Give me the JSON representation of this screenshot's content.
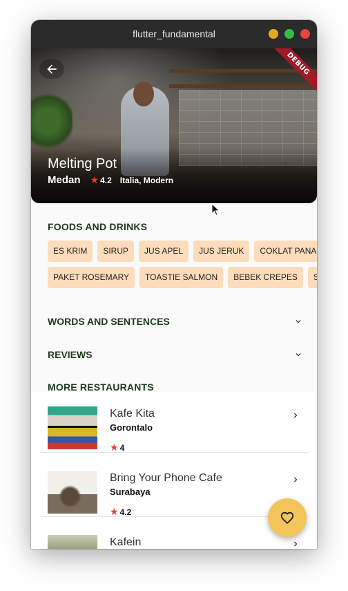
{
  "window": {
    "title": "flutter_fundamental"
  },
  "debug_banner": "DEBUG",
  "hero": {
    "name": "Melting Pot",
    "city": "Medan",
    "rating": "4.2",
    "categories": "Italia, Modern"
  },
  "foods_drinks": {
    "title": "FOODS AND DRINKS",
    "row1": [
      "ES KRIM",
      "SIRUP",
      "JUS APEL",
      "JUS JERUK",
      "COKLAT PANAS"
    ],
    "row2": [
      "PAKET ROSEMARY",
      "TOASTIE SALMON",
      "BEBEK CREPES",
      "SALAD"
    ]
  },
  "sections": {
    "words": "WORDS AND SENTENCES",
    "reviews": "REVIEWS",
    "more": "MORE RESTAURANTS"
  },
  "restaurants": [
    {
      "name": "Kafe Kita",
      "city": "Gorontalo",
      "rating": "4"
    },
    {
      "name": "Bring Your Phone Cafe",
      "city": "Surabaya",
      "rating": "4.2"
    },
    {
      "name": "Kafein",
      "city": "",
      "rating": ""
    }
  ],
  "icons": {
    "back": "arrow-back-icon",
    "expand": "chevron-down-icon",
    "row_arrow": "chevron-right-icon",
    "fab": "heart-outline-icon",
    "star": "star-icon"
  },
  "colors": {
    "chip_bg": "#fcdcbb",
    "section_text": "#1d3a1d",
    "star": "#e53935",
    "fab": "#f2c45a",
    "titlebar": "#2b2b2b"
  }
}
